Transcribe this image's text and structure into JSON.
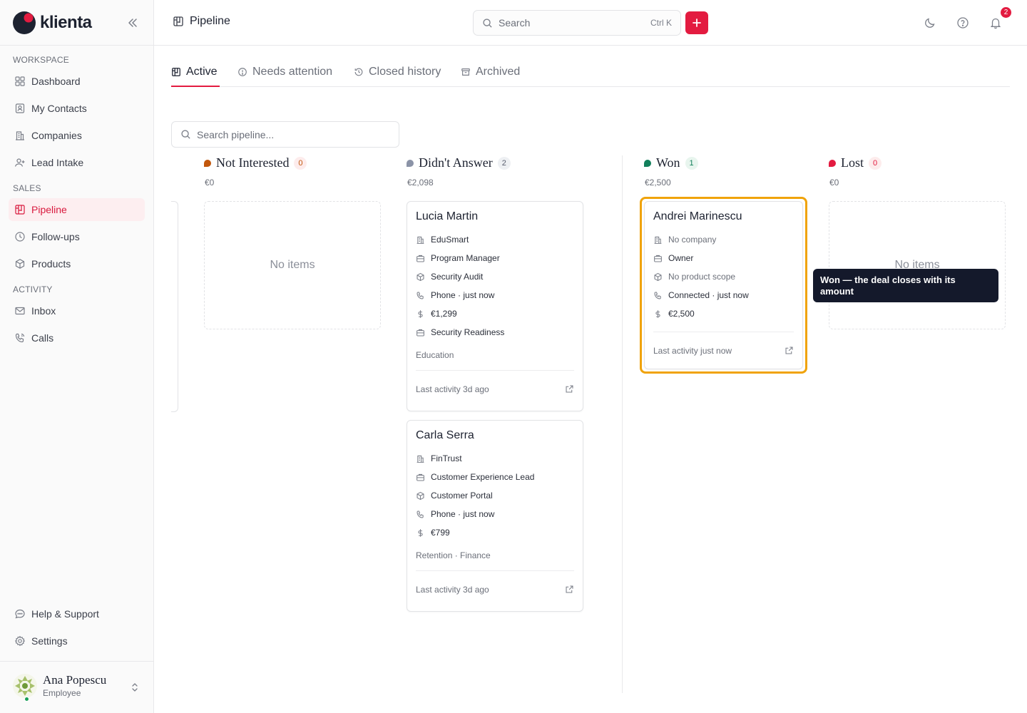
{
  "app": {
    "name": "klienta"
  },
  "sidebar": {
    "sections": {
      "workspace": "WORKSPACE",
      "sales": "SALES",
      "activity": "ACTIVITY"
    },
    "items": {
      "dashboard": "Dashboard",
      "contacts": "My Contacts",
      "companies": "Companies",
      "lead_intake": "Lead Intake",
      "pipeline": "Pipeline",
      "followups": "Follow-ups",
      "products": "Products",
      "inbox": "Inbox",
      "calls": "Calls",
      "help": "Help & Support",
      "settings": "Settings"
    },
    "user": {
      "name": "Ana Popescu",
      "role": "Employee"
    }
  },
  "header": {
    "title": "Pipeline",
    "search_placeholder": "Search",
    "search_shortcut": "Ctrl K",
    "notification_count": "2"
  },
  "tabs": [
    {
      "label": "Active"
    },
    {
      "label": "Needs attention"
    },
    {
      "label": "Closed history"
    },
    {
      "label": "Archived"
    }
  ],
  "pipeline_search": {
    "placeholder": "Search pipeline..."
  },
  "columns": [
    {
      "name": "Not Interested",
      "count": "0",
      "total": "€0",
      "empty_text": "No items",
      "color": "#c2570c"
    },
    {
      "name": "Didn't Answer",
      "count": "2",
      "total": "€2,098",
      "color": "#8b93a7"
    },
    {
      "name": "Won",
      "count": "1",
      "total": "€2,500",
      "color": "#12805c"
    },
    {
      "name": "Lost",
      "count": "0",
      "total": "€0",
      "empty_text": "No items",
      "color": "#e31b40"
    }
  ],
  "cards": {
    "lucia": {
      "name": "Lucia Martin",
      "company": "EduSmart",
      "role": "Program Manager",
      "product": "Security Audit",
      "contact": "Phone · just now",
      "amount": "€1,299",
      "campaign": "Security Readiness",
      "tags": "Education",
      "last_activity": "Last activity 3d ago"
    },
    "carla": {
      "name": "Carla Serra",
      "company": "FinTrust",
      "role": "Customer Experience Lead",
      "product": "Customer Portal",
      "contact": "Phone · just now",
      "amount": "€799",
      "tags": "Retention · Finance",
      "last_activity": "Last activity 3d ago"
    },
    "andrei": {
      "name": "Andrei Marinescu",
      "company": "No company",
      "role": "Owner",
      "product": "No product scope",
      "contact": "Connected · just now",
      "amount": "€2,500",
      "last_activity": "Last activity just now"
    }
  },
  "tooltip": {
    "text": "Won — the deal closes with its amount"
  },
  "colors": {
    "accent": "#e31b40",
    "highlight": "#f0a30a"
  }
}
